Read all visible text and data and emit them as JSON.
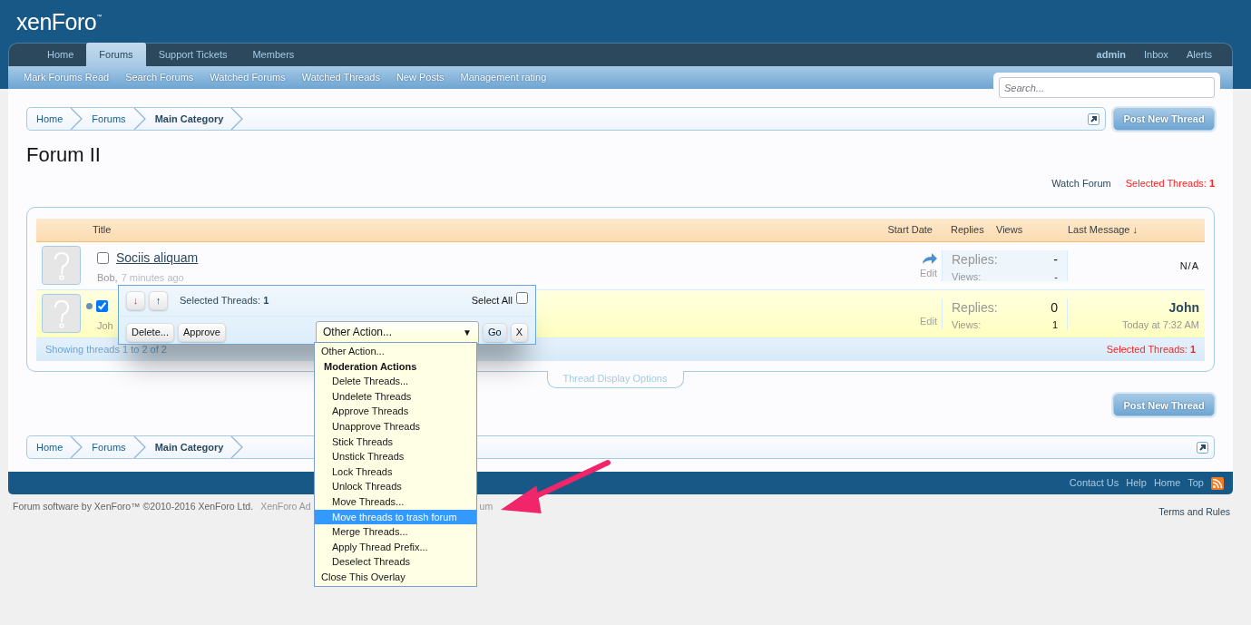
{
  "logo": "xenForo$^{™}$",
  "nav": {
    "tabs": [
      {
        "label": "Home",
        "selected": false
      },
      {
        "label": "Forums",
        "selected": true
      },
      {
        "label": "Support Tickets",
        "selected": false
      },
      {
        "label": "Members",
        "selected": false
      }
    ],
    "user_links": [
      "admin",
      "Inbox",
      "Alerts"
    ]
  },
  "subnav": [
    "Mark Forums Read",
    "Search Forums",
    "Watched Forums",
    "Watched Threads",
    "New Posts",
    "Management rating"
  ],
  "search": {
    "placeholder": "Search..."
  },
  "breadcrumb_top": [
    {
      "label": "Home",
      "current": false
    },
    {
      "label": "Forums",
      "current": false
    },
    {
      "label": "Main Category",
      "current": true
    }
  ],
  "post_button_top": "Post New Thread",
  "title": "Forum II",
  "watch_forum": "Watch Forum",
  "selected_threads_top": {
    "label": "Selected Threads:",
    "count": "1"
  },
  "thread_list": {
    "columns": [
      {
        "label": "Title"
      },
      {
        "label": "Start Date"
      },
      {
        "label": "Replies"
      },
      {
        "label": "Views"
      },
      {
        "label": "Last Message ↓"
      }
    ],
    "threads": [
      {
        "title": "Sociis aliquam",
        "author": "Bob,",
        "time": "7 minutes ago",
        "checked": false,
        "selected": false,
        "unread": false,
        "shared": true,
        "edit": "Edit",
        "replies_label": "Replies:",
        "replies": "-",
        "views_label": "Views:",
        "views": "-",
        "last_user": "N/A"
      },
      {
        "author": "Joh",
        "checked": true,
        "selected": true,
        "unread": true,
        "shared": false,
        "edit": "Edit",
        "replies_label": "Replies:",
        "replies": "0",
        "views_label": "Views:",
        "views": "1",
        "last_user": "John",
        "last_time": "Today at 7:32 AM"
      }
    ],
    "showing": "Showing threads 1 to 2 of 2",
    "selected_threads": {
      "label": "Selected Threads:",
      "count": "1"
    },
    "display_options": "Thread Display Options"
  },
  "post_button_bottom": "Post New Thread",
  "breadcrumb_bottom": [
    {
      "label": "Home",
      "current": false
    },
    {
      "label": "Forums",
      "current": false
    },
    {
      "label": "Main Category",
      "current": true
    }
  ],
  "footer_links": [
    "Contact Us",
    "Help",
    "Home",
    "Top"
  ],
  "credits": [
    "Forum software by XenForo™ ©2010-2016 XenForo Ltd.",
    "XenForo Ad",
    "um"
  ],
  "terms": "Terms and Rules",
  "moderation": {
    "down": "↓",
    "up": "↑",
    "selected_label": "Selected Threads:",
    "selected_count": "1",
    "select_all": "Select All",
    "select_all_checked": false,
    "buttons": [
      "Delete...",
      "Approve"
    ],
    "action_value": "Other Action...",
    "caret": "▼",
    "go": "Go",
    "close": "X"
  },
  "action_menu": [
    {
      "label": "Other Action...",
      "kind": "option",
      "selected": false
    },
    {
      "label": "Moderation Actions",
      "kind": "group",
      "selected": false
    },
    {
      "label": "Delete Threads...",
      "kind": "suboption",
      "selected": false
    },
    {
      "label": "Undelete Threads",
      "kind": "suboption",
      "selected": false
    },
    {
      "label": "Approve Threads",
      "kind": "suboption",
      "selected": false
    },
    {
      "label": "Unapprove Threads",
      "kind": "suboption",
      "selected": false
    },
    {
      "label": "Stick Threads",
      "kind": "suboption",
      "selected": false
    },
    {
      "label": "Unstick Threads",
      "kind": "suboption",
      "selected": false
    },
    {
      "label": "Lock Threads",
      "kind": "suboption",
      "selected": false
    },
    {
      "label": "Unlock Threads",
      "kind": "suboption",
      "selected": false
    },
    {
      "label": "Move Threads...",
      "kind": "suboption",
      "selected": false
    },
    {
      "label": "Move threads to trash forum",
      "kind": "suboption",
      "selected": true
    },
    {
      "label": "Merge Threads...",
      "kind": "suboption",
      "selected": false
    },
    {
      "label": "Apply Thread Prefix...",
      "kind": "suboption",
      "selected": false
    },
    {
      "label": "Deselect Threads",
      "kind": "suboption",
      "selected": false
    },
    {
      "label": "Close This Overlay",
      "kind": "option",
      "selected": false
    }
  ]
}
